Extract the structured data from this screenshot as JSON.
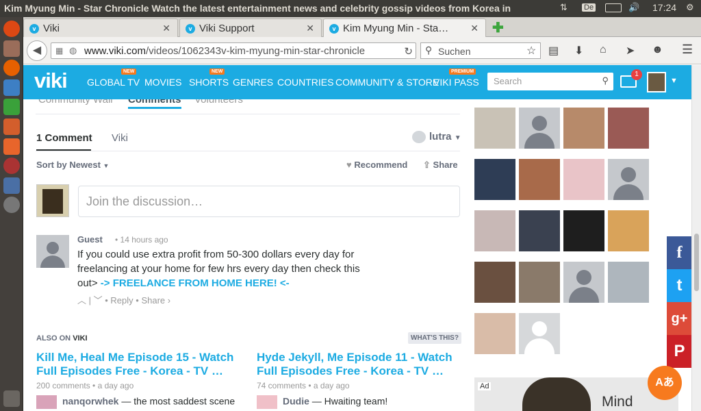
{
  "window": {
    "title": "Kim Myung Min - Star Chronicle Watch the latest entertainment news and celebrity gossip videos from Korea in",
    "clock": "17:24",
    "lang": "De"
  },
  "tabs": [
    {
      "label": "Viki"
    },
    {
      "label": "Viki Support"
    },
    {
      "label": "Kim Myung Min - Sta…"
    }
  ],
  "addressbar": {
    "domain": "www.viki.com",
    "path": "/videos/1062343v-kim-myung-min-star-chronicle",
    "search_placeholder": "Suchen"
  },
  "viki": {
    "logo": "viki",
    "nav": [
      {
        "label": "GLOBAL TV",
        "badge": "NEW"
      },
      {
        "label": "MOVIES"
      },
      {
        "label": "SHORTS",
        "badge": "NEW"
      },
      {
        "label": "GENRES"
      },
      {
        "label": "COUNTRIES"
      },
      {
        "label": "COMMUNITY & STORE"
      },
      {
        "label": "VIKI PASS",
        "badge": "PREMIUM"
      }
    ],
    "search_placeholder": "Search",
    "notifications": "1"
  },
  "page_tabs": [
    {
      "label": "Community Wall"
    },
    {
      "label": "Comments"
    },
    {
      "label": "Volunteers"
    }
  ],
  "disqus": {
    "tab_comments": "1 Comment",
    "tab_site": "Viki",
    "user": "lutra",
    "sort": "Sort by Newest",
    "recommend": "Recommend",
    "share": "Share",
    "join_placeholder": "Join the discussion…",
    "comment": {
      "author": "Guest",
      "time": "14 hours ago",
      "text": "If you could use extra profit from 50-300 dollars every day for freelancing at your home for few hrs every day then check this out>",
      "link": "-> FREELANCE FROM HOME HERE! <-",
      "reply": "Reply",
      "share": "Share ›"
    }
  },
  "also": {
    "prefix": "ALSO ON",
    "site": "VIKI",
    "whats": "WHAT'S THIS?",
    "items": [
      {
        "title": "Kill Me, Heal Me Episode 15 - Watch Full Episodes Free - Korea - TV …",
        "meta": "200 comments • a day ago",
        "author": "nanqorwhek",
        "snippet": "— the most saddest scene"
      },
      {
        "title": "Hyde Jekyll, Me Episode 11 - Watch Full Episodes Free - Korea - TV …",
        "meta": "74 comments • a day ago",
        "author": "Dudie",
        "snippet": "— Hwaiting team!"
      }
    ]
  },
  "ad": {
    "tag": "Ad",
    "brand": "Mind Bridge"
  },
  "social": {
    "facebook": "f",
    "twitter": "t",
    "gplus": "g+",
    "pinterest": "P"
  },
  "translate": "Aあ"
}
